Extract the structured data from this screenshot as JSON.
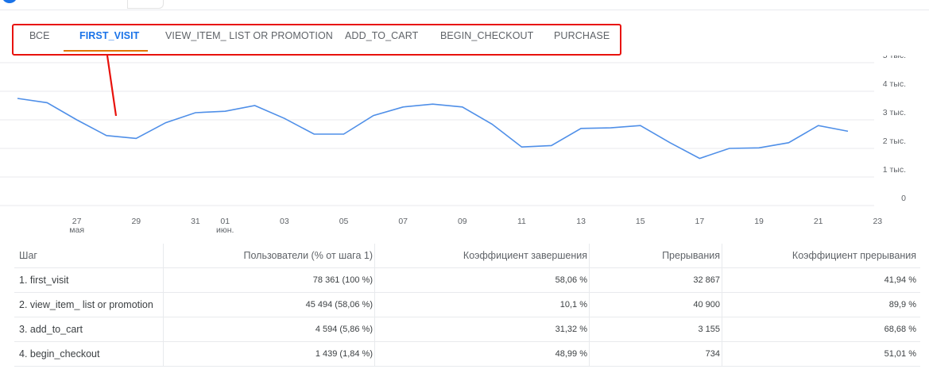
{
  "tabs": [
    {
      "label": "ВСЕ",
      "active": false
    },
    {
      "label": "FIRST_VISIT",
      "active": true
    },
    {
      "label": "VIEW_ITEM_ LIST OR PROMOTION",
      "active": false
    },
    {
      "label": "ADD_TO_CART",
      "active": false
    },
    {
      "label": "BEGIN_CHECKOUT",
      "active": false
    },
    {
      "label": "PURCHASE",
      "active": false
    }
  ],
  "colors": {
    "line": "#4f8fe8",
    "active_tab": "#1a73e8",
    "underline": "#e37400",
    "annotation": "#e8120c"
  },
  "chart_data": {
    "type": "line",
    "series": [
      {
        "values": [
          3750,
          3600,
          3000,
          2450,
          2350,
          2900,
          3250,
          3300,
          3500,
          3050,
          2500,
          2500,
          3150,
          3450,
          3550,
          3450,
          2850,
          2050,
          2100,
          2700,
          2720,
          2800,
          2200,
          1650,
          2000,
          2020,
          2200,
          2800,
          2600
        ]
      }
    ],
    "x_ticks": [
      "27",
      "29",
      "31",
      "01",
      "03",
      "05",
      "07",
      "09",
      "11",
      "13",
      "15",
      "17",
      "19",
      "21",
      "23"
    ],
    "x_subticks": [
      "мая",
      "июн."
    ],
    "y_ticks": [
      "5 тыс.",
      "4 тыс.",
      "3 тыс.",
      "2 тыс.",
      "1 тыс.",
      "0"
    ],
    "ylim": [
      0,
      5000
    ]
  },
  "table": {
    "headers": [
      "Шаг",
      "Пользователи (% от шага 1)",
      "Коэффициент завершения",
      "Прерывания",
      "Коэффициент прерывания"
    ],
    "rows": [
      [
        "1. first_visit",
        "78 361 (100 %)",
        "58,06 %",
        "32 867",
        "41,94 %"
      ],
      [
        "2. view_item_ list or promotion",
        "45 494 (58,06 %)",
        "10,1 %",
        "40 900",
        "89,9 %"
      ],
      [
        "3. add_to_cart",
        "4 594 (5,86 %)",
        "31,32 %",
        "3 155",
        "68,68 %"
      ],
      [
        "4. begin_checkout",
        "1 439 (1,84 %)",
        "48,99 %",
        "734",
        "51,01 %"
      ]
    ]
  }
}
